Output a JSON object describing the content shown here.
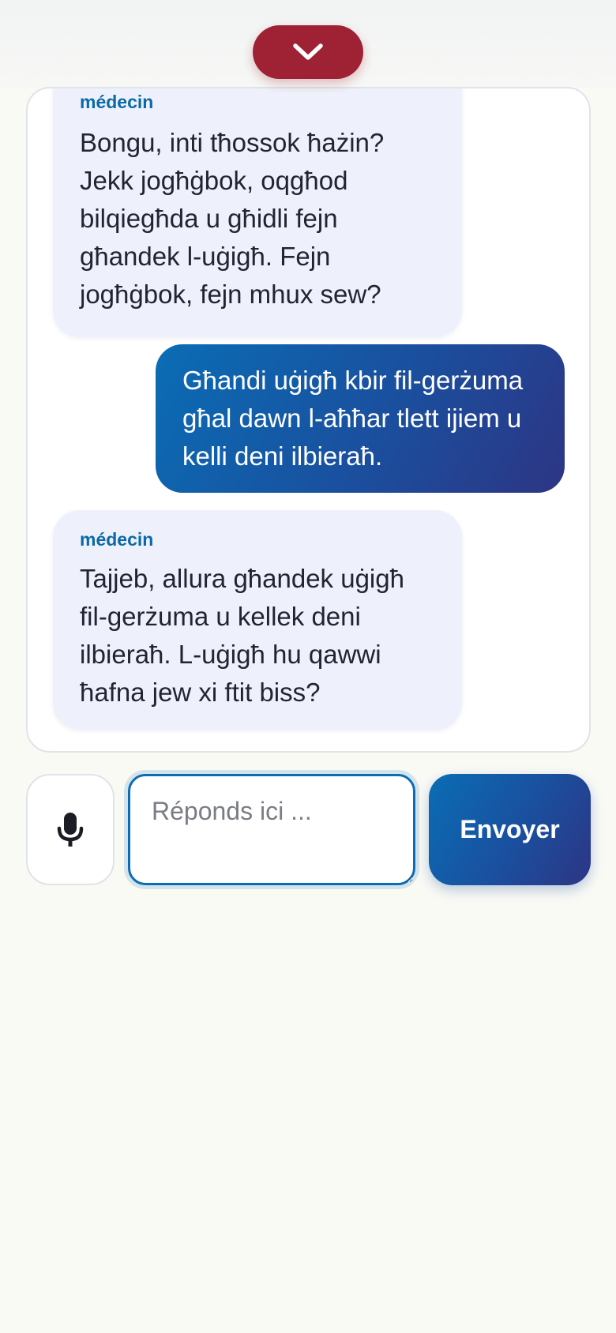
{
  "header": {
    "collapse_icon": "chevron-down-icon",
    "collapse_color": "#9e2134"
  },
  "conversation": {
    "messages": [
      {
        "role": "bot",
        "author": "médecin",
        "text": "Bongu, inti tħossok ħażin? Jekk jogħġbok, oqgħod bilqiegħda u għidli fejn għandek l-uġigħ. Fejn jogħġbok, fejn mhux sew?"
      },
      {
        "role": "user",
        "text": "Għandi uġigħ kbir fil-gerżuma għal dawn l-aħħar tlett ijiem u kelli deni ilbieraħ."
      },
      {
        "role": "bot",
        "author": "médecin",
        "text": "Tajjeb, allura għandek uġigħ fil-gerżuma u kellek deni ilbieraħ. L-uġigħ hu qawwi ħafna jew xi ftit biss?"
      }
    ]
  },
  "composer": {
    "mic_icon": "microphone-icon",
    "placeholder": "Réponds ici ...",
    "value": "",
    "send_label": "Envoyer"
  },
  "colors": {
    "accent": "#0a6db5",
    "accent_dark": "#2d3584",
    "author_label": "#0b6aa6",
    "bot_bubble": "#eef1fb"
  }
}
